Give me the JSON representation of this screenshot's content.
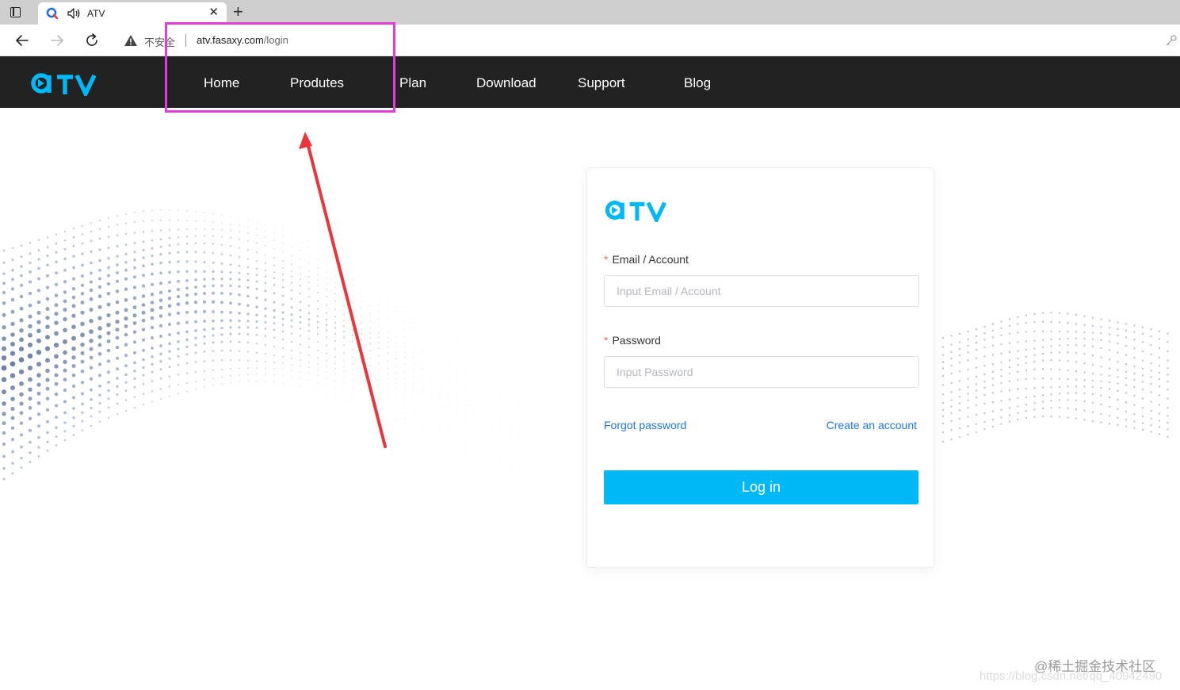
{
  "browser": {
    "tab_title": "ATV",
    "security_label": "不安全",
    "url_host": "atv.fasaxy.com",
    "url_path": "/login"
  },
  "site": {
    "brand_color": "#00b8f5",
    "nav": [
      "Home",
      "Produtes",
      "Plan",
      "Download",
      "Support",
      "Blog"
    ]
  },
  "login": {
    "email_label": "Email / Account",
    "email_placeholder": "Input Email / Account",
    "password_label": "Password",
    "password_placeholder": "Input Password",
    "required_mark": "*",
    "forgot_link": "Forgot password",
    "create_link": "Create an account",
    "submit_label": "Log in"
  },
  "watermark": {
    "line1": "@稀土掘金技术社区",
    "line2": "https://blog.csdn.net/qq_40942490"
  },
  "annotation_color": "#e13ddb",
  "arrow_color": "#e8363c"
}
